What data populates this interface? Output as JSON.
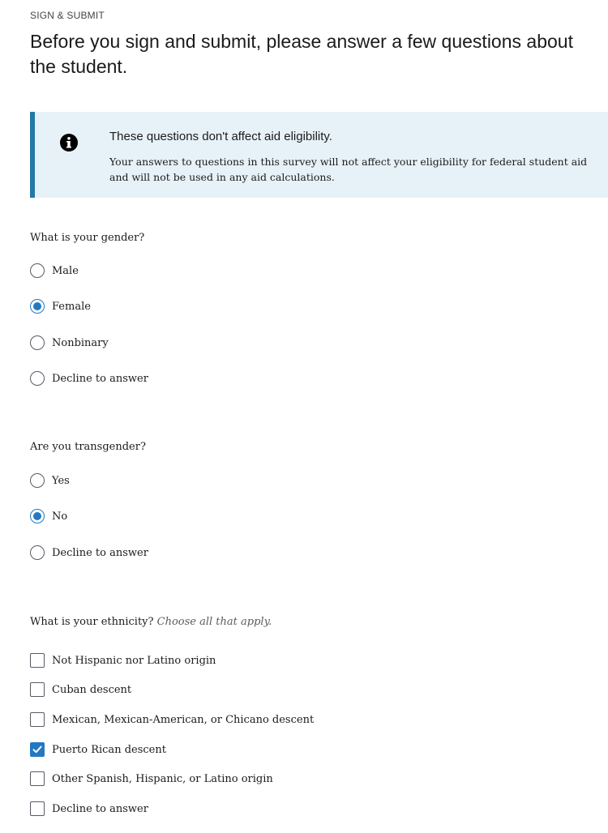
{
  "header": {
    "eyebrow": "SIGN & SUBMIT",
    "title": "Before you sign and submit, please answer a few questions about the student."
  },
  "alert": {
    "icon": "info-icon",
    "title": "These questions don't affect aid eligibility.",
    "body": "Your answers to questions in this survey will not affect your eligibility for federal student aid and will not be used in any aid calculations."
  },
  "gender": {
    "question": "What is your gender?",
    "options": [
      {
        "label": "Male",
        "checked": false
      },
      {
        "label": "Female",
        "checked": true
      },
      {
        "label": "Nonbinary",
        "checked": false
      },
      {
        "label": "Decline to answer",
        "checked": false
      }
    ]
  },
  "transgender": {
    "question": "Are you transgender?",
    "options": [
      {
        "label": "Yes",
        "checked": false
      },
      {
        "label": "No",
        "checked": true
      },
      {
        "label": "Decline to answer",
        "checked": false
      }
    ]
  },
  "ethnicity": {
    "question": "What is your ethnicity?",
    "hint": "Choose all that apply.",
    "options": [
      {
        "label": "Not Hispanic nor Latino origin",
        "checked": false
      },
      {
        "label": "Cuban descent",
        "checked": false
      },
      {
        "label": "Mexican, Mexican-American, or Chicano descent",
        "checked": false
      },
      {
        "label": "Puerto Rican descent",
        "checked": true
      },
      {
        "label": "Other Spanish, Hispanic, or Latino origin",
        "checked": false
      },
      {
        "label": "Decline to answer",
        "checked": false
      }
    ]
  },
  "colors": {
    "accent": "#2378c3",
    "alert_bg": "#e7f2f8",
    "alert_border": "#2378a8"
  }
}
